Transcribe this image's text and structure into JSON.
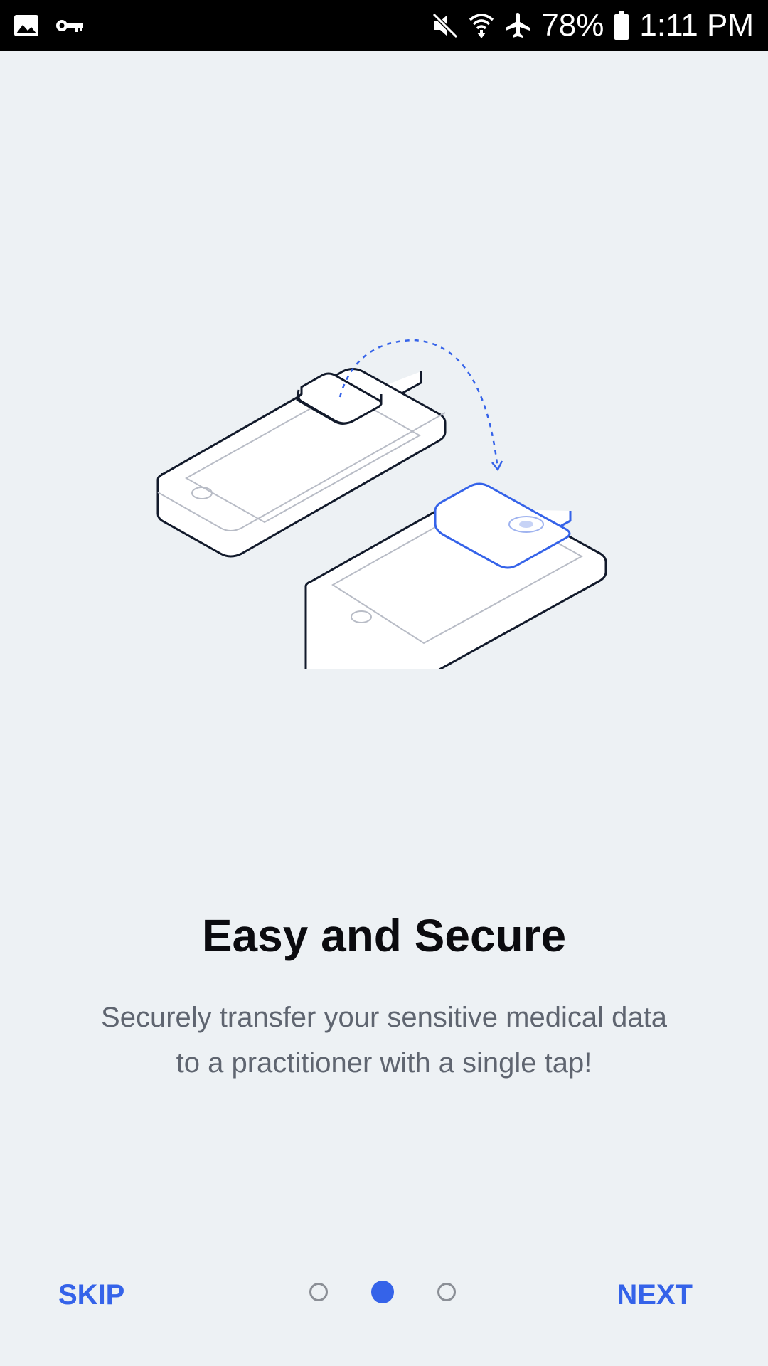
{
  "status_bar": {
    "battery": "78%",
    "time": "1:11 PM",
    "left_icons": [
      "image-icon",
      "key-icon"
    ],
    "right_icons": [
      "mute-icon",
      "wifi-icon",
      "airplane-icon",
      "battery-icon"
    ]
  },
  "onboarding": {
    "title": "Easy and Secure",
    "description": "Securely transfer your sensitive medical data to a practitioner with a single tap!",
    "illustration": "two-phones-transfer-illustration"
  },
  "navigation": {
    "skip_label": "SKIP",
    "next_label": "NEXT",
    "page_count": 3,
    "current_page": 2
  },
  "colors": {
    "accent": "#3563e9",
    "background": "#edf1f4",
    "status_bar": "#000000",
    "title": "#0b0b0f",
    "description": "#5f6570"
  }
}
